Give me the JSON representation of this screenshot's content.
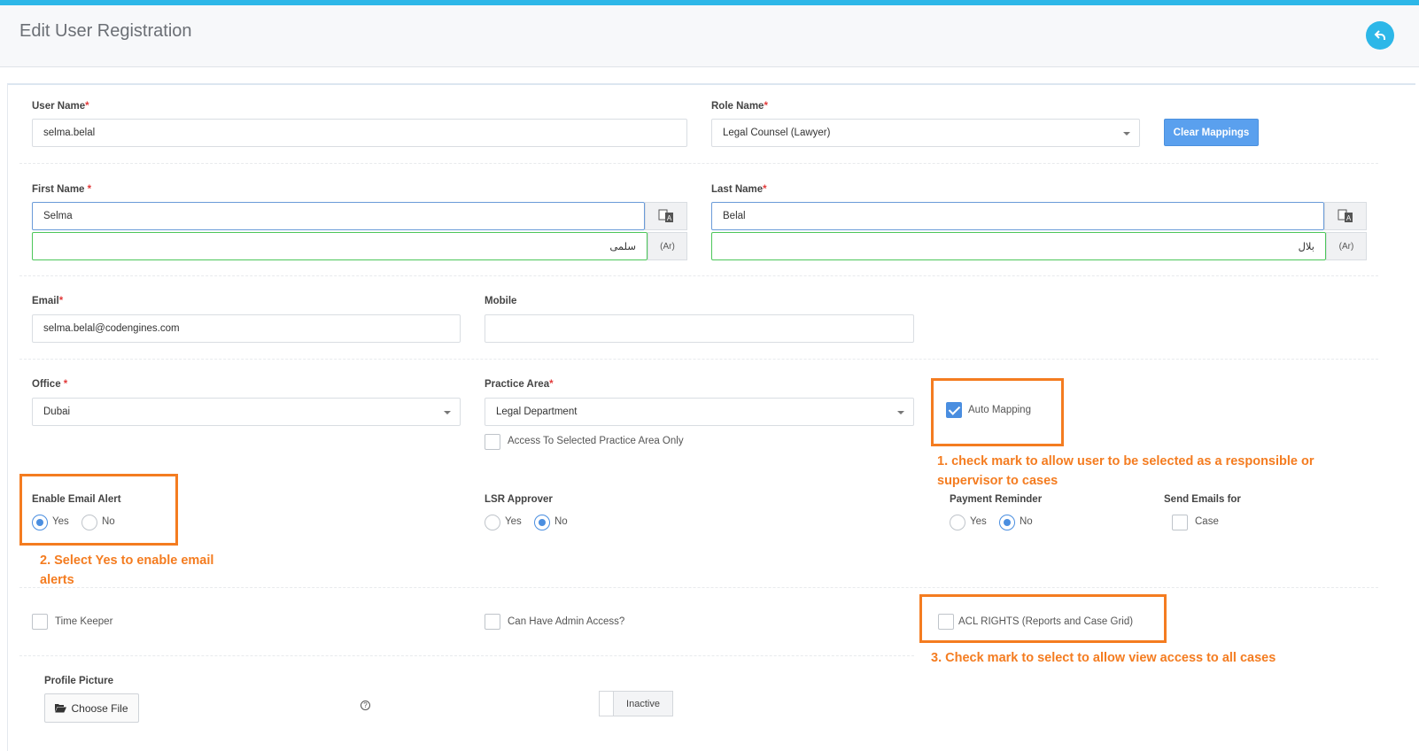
{
  "header": {
    "title": "Edit User Registration",
    "back_icon": "back-arrow-icon"
  },
  "required_mark": "*",
  "fields": {
    "user_name": {
      "label": "User Name",
      "value": "selma.belal"
    },
    "role_name": {
      "label": "Role Name",
      "value": "Legal Counsel (Lawyer)"
    },
    "clear_mappings": "Clear Mappings",
    "first_name": {
      "label": "First Name",
      "value": "Selma",
      "arabic_value": "سلمى",
      "arabic_addon": "(Ar)"
    },
    "last_name": {
      "label": "Last Name",
      "value": "Belal",
      "arabic_value": "بلال",
      "arabic_addon": "(Ar)"
    },
    "email": {
      "label": "Email",
      "value": "selma.belal@codengines.com"
    },
    "mobile": {
      "label": "Mobile",
      "value": ""
    },
    "office": {
      "label": "Office",
      "value": "Dubai"
    },
    "practice_area": {
      "label": "Practice Area",
      "value": "Legal Department"
    },
    "access_selected_area": {
      "label": "Access To Selected Practice Area Only",
      "checked": false
    },
    "auto_mapping": {
      "label": "Auto Mapping",
      "checked": true
    },
    "enable_email_alert": {
      "label": "Enable Email Alert",
      "yes": "Yes",
      "no": "No",
      "selected": "Yes"
    },
    "lsr_approver": {
      "label": "LSR Approver",
      "yes": "Yes",
      "no": "No",
      "selected": "No"
    },
    "payment_reminder": {
      "label": "Payment Reminder",
      "yes": "Yes",
      "no": "No",
      "selected": "No"
    },
    "send_emails_for": {
      "label": "Send Emails for",
      "option": "Case",
      "checked": false
    },
    "time_keeper": {
      "label": "Time Keeper",
      "checked": false
    },
    "admin_access": {
      "label": "Can Have Admin Access?",
      "checked": false
    },
    "acl_rights": {
      "label": "ACL RIGHTS (Reports and Case Grid)",
      "checked": false
    },
    "profile_picture": {
      "label": "Profile Picture",
      "button": "Choose File"
    },
    "status_toggle": {
      "label": "Inactive"
    },
    "help": "?"
  },
  "annotations": {
    "note1": "1. check mark to allow user to be selected as a responsible or supervisor to cases",
    "note2": "2. Select Yes to enable email alerts",
    "note3": "3. Check mark to select to allow view access to all cases"
  },
  "colors": {
    "accent": "#2db7e8",
    "primary_button": "#5aa0ee",
    "annotation": "#f47c20",
    "arabic_border": "#4cc65a"
  }
}
